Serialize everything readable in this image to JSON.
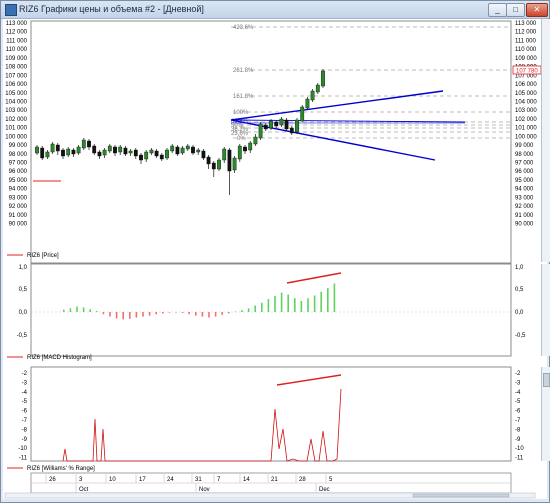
{
  "window": {
    "title": "RIZ6 Графики цены и объема #2 - [Дневной]",
    "buttons": {
      "min": "_",
      "max": "□",
      "close": "✕"
    }
  },
  "price_pane": {
    "y_ticks": [
      "113 000",
      "112 000",
      "111 000",
      "110 000",
      "109 000",
      "108 000",
      "107 000",
      "106 000",
      "105 000",
      "104 000",
      "103 000",
      "102 000",
      "101 000",
      "100 000",
      "99 000",
      "98 000",
      "97 000",
      "96 000",
      "95 000",
      "94 000",
      "93 000",
      "92 000",
      "91 000",
      "90 000"
    ],
    "last_price_label": "107 780",
    "fib_labels": [
      "423.6%",
      "261.8%",
      "161.8%",
      "100%",
      "61.8%",
      "50%",
      "38.2%",
      "23.6%",
      "0%"
    ],
    "legend": "RIZ6 [Price]",
    "colors": {
      "up": "#2a8a2a",
      "down": "#111111",
      "trend": "#0000d0",
      "level_red": "#e02020"
    }
  },
  "macd_pane": {
    "y_ticks": [
      "1,0",
      "0,5",
      "0,0",
      "-0,5"
    ],
    "legend": "RIZ6 [MACD Histogram]"
  },
  "williams_pane": {
    "y_ticks": [
      "-2",
      "-3",
      "-4",
      "-5",
      "-6",
      "-7",
      "-8",
      "-9",
      "-10",
      "-11"
    ],
    "legend": "RIZ6 [Williams' % Range]"
  },
  "time_axis": {
    "days": [
      "26",
      "3",
      "10",
      "17",
      "24",
      "31",
      "7",
      "14",
      "21",
      "28",
      "5"
    ],
    "months": [
      "Oct",
      "Nov",
      "Dec"
    ]
  }
}
